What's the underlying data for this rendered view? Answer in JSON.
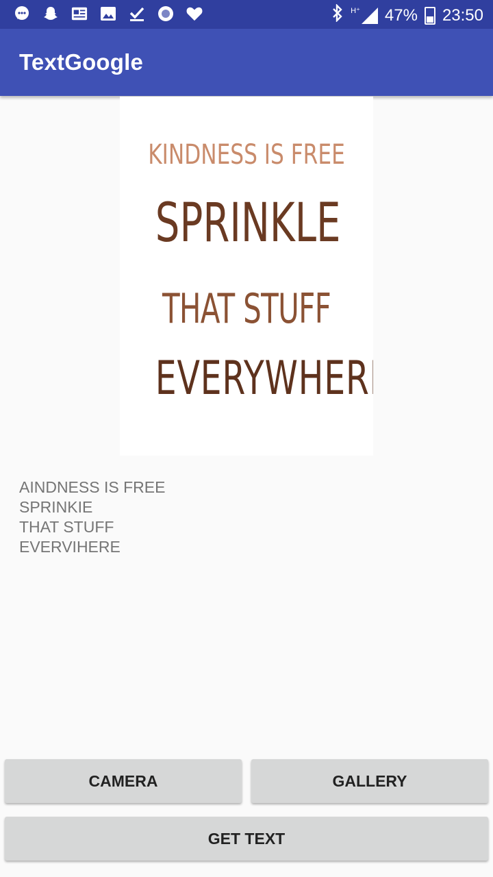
{
  "status_bar": {
    "icons": [
      "chat-icon",
      "snapchat-icon",
      "news-icon",
      "image-icon",
      "checkmark-icon",
      "circle-icon",
      "heart-icon"
    ],
    "battery": "47%",
    "time": "23:50"
  },
  "app_bar": {
    "title": "TextGoogle"
  },
  "poster": {
    "lines": [
      "Kindness is free",
      "Sprinkle",
      "That stuff",
      "Everywhere"
    ]
  },
  "ocr_result": {
    "lines": [
      "AINDNESS IS FREE",
      "SPRINKIE",
      "THAT STUFF",
      "EVERVIHERE"
    ]
  },
  "buttons": {
    "camera": "CAMERA",
    "gallery": "GALLERY",
    "get_text": "GET TEXT"
  },
  "colors": {
    "status_bar": "#303f9f",
    "app_bar": "#3f51b5",
    "button": "#d6d7d7",
    "background": "#fafafa"
  }
}
